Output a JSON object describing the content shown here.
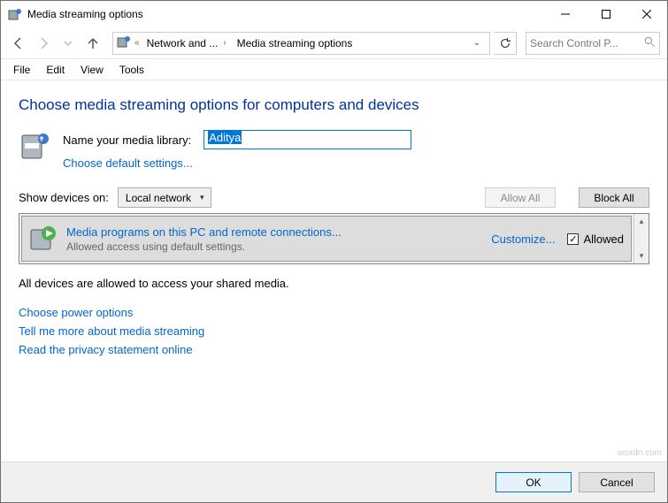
{
  "window": {
    "title": "Media streaming options"
  },
  "breadcrumb": {
    "first": "Network and ...",
    "second": "Media streaming options"
  },
  "search": {
    "placeholder": "Search Control P..."
  },
  "menu": {
    "file": "File",
    "edit": "Edit",
    "view": "View",
    "tools": "Tools"
  },
  "page": {
    "title": "Choose media streaming options for computers and devices",
    "library_label": "Name your media library:",
    "library_value": "Aditya",
    "choose_defaults": "Choose default settings...",
    "show_devices_label": "Show devices on:",
    "show_devices_value": "Local network",
    "allow_all": "Allow All",
    "block_all": "Block All"
  },
  "device": {
    "line1": "Media programs on this PC and remote connections...",
    "line2": "Allowed access using default settings.",
    "customize": "Customize...",
    "allowed": "Allowed",
    "checked": true
  },
  "status": "All devices are allowed to access your shared media.",
  "links": {
    "power": "Choose power options",
    "more": "Tell me more about media streaming",
    "privacy": "Read the privacy statement online"
  },
  "footer": {
    "ok": "OK",
    "cancel": "Cancel"
  },
  "watermark": "wsxdn.com"
}
